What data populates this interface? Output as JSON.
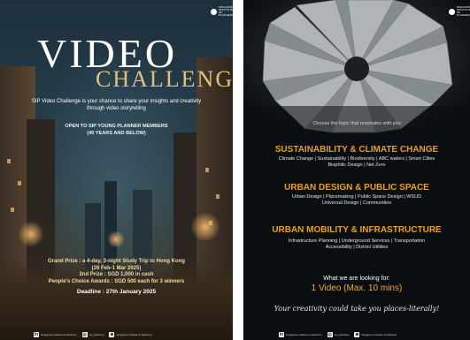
{
  "left_poster": {
    "logo_text": "SINGAPORE INSTITUTE OF PLANNERS",
    "title_word_1": "VIDEO",
    "title_word_2": "CHALLENGE",
    "intro": "SIP Video Challenge is your chance to share your insights and creativity through video storytelling",
    "open_line_1": "OPEN TO SIP YOUNG PLANNER MEMBERS",
    "open_line_2": "(40 YEARS AND BELOW)",
    "prize_line_1": "Grand Prize : a 4-day, 3-night Study Trip to Hong Kong",
    "prize_line_2": "(26 Feb-1 Mar 2025)",
    "prize_line_3": "2nd Prize : SGD 1,000 in cash",
    "prize_line_4": "People's Choice Awards : SGD 500 each for 3 winners",
    "deadline": "Deadline : 27th January 2025",
    "footer": {
      "linkedin_text": "singapore-institute-of-planners",
      "instagram_text": "sip_planning",
      "web_text": "singapore institute of planners"
    }
  },
  "right_poster": {
    "logo_text": "SINGAPORE INSTITUTE OF PLANNERS",
    "choose_text": "Choose the topic that resonates with you",
    "topics": [
      {
        "heading": "SUSTAINABILITY & CLIMATE CHANGE",
        "line_1": "Climate Change | Sustainability | Biodiversity | ABC waters | Smart Cities",
        "line_2": "Biophilic Design | Net Zero"
      },
      {
        "heading": "URBAN DESIGN & PUBLIC SPACE",
        "line_1": "Urban Design | Placemaking | Public Space Design | WSUD",
        "line_2": "Universal Design | Communities"
      },
      {
        "heading": "URBAN MOBILITY & INFRASTRUCTURE",
        "line_1": "Infrastructure Planning | Underground Services | Transportation",
        "line_2": "Accessibility | District Utilities"
      }
    ],
    "looking_for": "What we are looking for:",
    "video_requirement": "1 Video (Max. 10 mins)",
    "tagline": "Your creativity could take you places-literally!",
    "footer": {
      "linkedin_text": "singapore-institute-of-planners",
      "instagram_text": "sip_planning",
      "web_text": "singapore institute of planners"
    }
  },
  "colors": {
    "accent_gold": "#e2c27a",
    "heading_orange": "#e8a020",
    "video_orange": "#f0a93a",
    "prize_gold": "#f7dca1",
    "right_bg": "#0b0e11"
  }
}
